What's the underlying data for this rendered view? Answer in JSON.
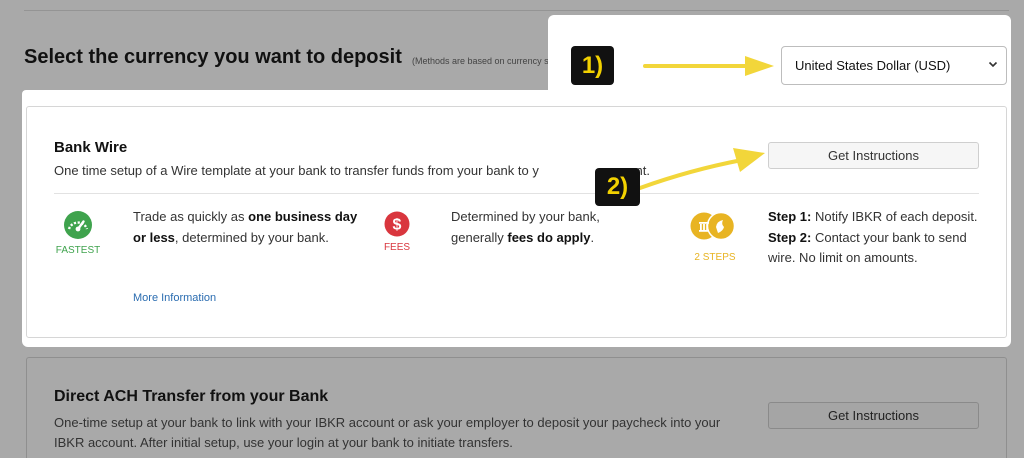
{
  "page": {
    "heading": "Select the currency you want to deposit",
    "heading_note": "(Methods are based on currency s"
  },
  "currency_select": {
    "value": "United States Dollar (USD)",
    "icon": "chevron-down-icon"
  },
  "callouts": {
    "step1": "1)",
    "step2": "2)"
  },
  "bank_wire": {
    "title": "Bank Wire",
    "description": "One time setup of a Wire template at your bank to transfer funds from your bank to y",
    "description_tail": "account.",
    "button": "Get Instructions",
    "features": [
      {
        "icon": "speedometer-icon",
        "label": "FASTEST",
        "color": "#3fa34d",
        "text_pre": "Trade as quickly as ",
        "text_bold": "one business day or less",
        "text_post": ", determined by your bank."
      },
      {
        "icon": "dollar-icon",
        "label": "FEES",
        "color": "#d9363e",
        "text_pre": "Determined by your bank, generally ",
        "text_bold": "fees do apply",
        "text_post": "."
      },
      {
        "icon": "steps-icon",
        "label": "2 STEPS",
        "color": "#e8b423",
        "step1_label": "Step 1:",
        "step1_text": " Notify IBKR of each deposit.",
        "step2_label": "Step 2:",
        "step2_text": " Contact your bank to send wire. No limit on amounts."
      }
    ],
    "more_link": "More Information"
  },
  "ach": {
    "title": "Direct ACH Transfer from your Bank",
    "description": "One-time setup at your bank to link with your IBKR account or ask your employer to deposit your paycheck into your IBKR account. After initial setup, use your login at your bank to initiate transfers.",
    "button": "Get Instructions"
  },
  "colors": {
    "arrow": "#f2d63a",
    "callout_bg": "#111111",
    "callout_text": "#f2d100",
    "link": "#2a6cb0"
  }
}
